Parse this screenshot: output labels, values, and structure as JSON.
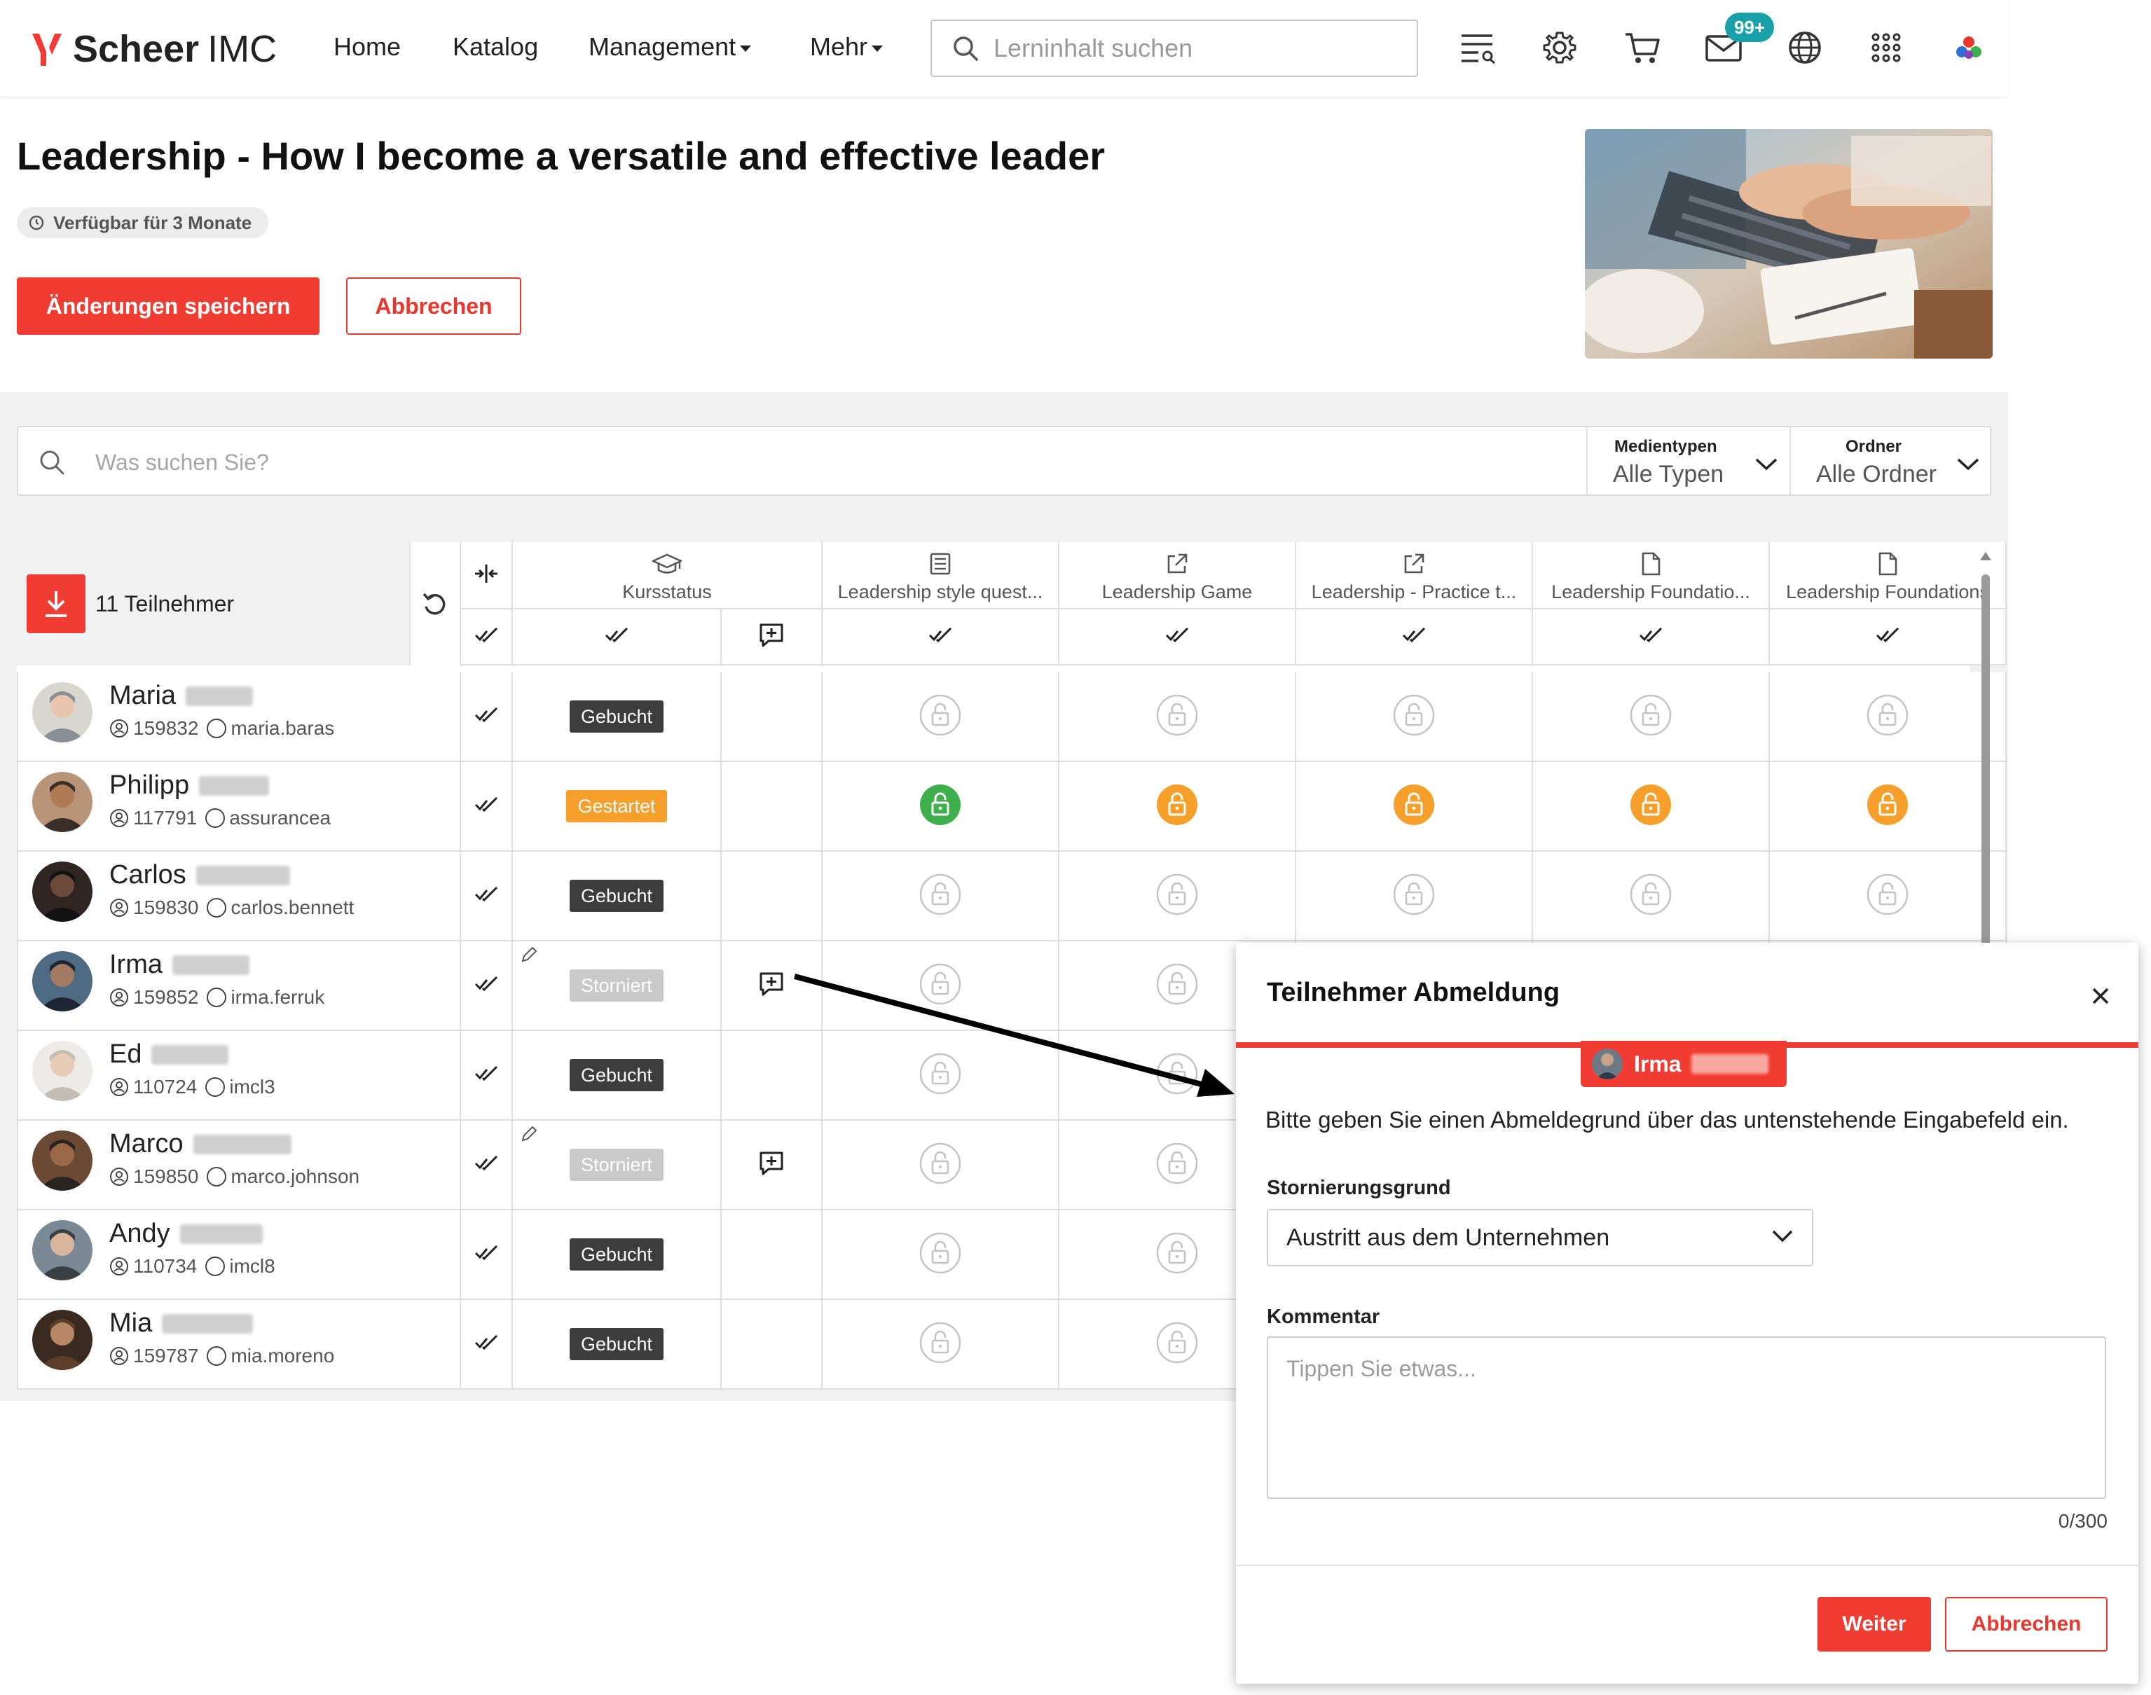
{
  "brand": {
    "name_strong": "Scheer",
    "name_light": "IMC",
    "accent": "#f03c32"
  },
  "nav": {
    "home": "Home",
    "catalog": "Katalog",
    "management": "Management",
    "more": "Mehr",
    "search_placeholder": "Lerninhalt suchen",
    "icons": [
      "filter-list-icon",
      "gear-icon",
      "cart-icon",
      "mail-icon",
      "globe-icon",
      "apps-grid-icon",
      "user-avatar"
    ],
    "mail_badge": "99+"
  },
  "course": {
    "title": "Leadership - How I become a versatile and effective leader",
    "availability": "Verfügbar für 3 Monate",
    "save_label": "Änderungen speichern",
    "cancel_label": "Abbrechen"
  },
  "filters": {
    "search_placeholder": "Was suchen Sie?",
    "media_label": "Medientypen",
    "media_value": "Alle Typen",
    "folder_label": "Ordner",
    "folder_value": "Alle Ordner"
  },
  "table": {
    "participants_label": "11 Teilnehmer",
    "status_header": "Kursstatus",
    "columns": [
      {
        "label": "Leadership style quest...",
        "icon": "questionnaire-icon"
      },
      {
        "label": "Leadership Game",
        "icon": "external-link-icon"
      },
      {
        "label": "Leadership - Practice t...",
        "icon": "external-link-icon"
      },
      {
        "label": "Leadership Foundatio...",
        "icon": "document-icon"
      },
      {
        "label": "Leadership Foundations",
        "icon": "document-icon"
      }
    ],
    "rows": [
      {
        "first_name": "Maria",
        "id": "159832",
        "username": "maria.baras",
        "status": "Gebucht",
        "status_kind": "gebucht",
        "comment": false,
        "locks": [
          "grey",
          "grey",
          "grey",
          "grey",
          "grey"
        ]
      },
      {
        "first_name": "Philipp",
        "id": "117791",
        "username": "assurancea",
        "status": "Gestartet",
        "status_kind": "gestartet",
        "comment": false,
        "locks": [
          "green",
          "orange",
          "orange",
          "orange",
          "orange"
        ]
      },
      {
        "first_name": "Carlos",
        "id": "159830",
        "username": "carlos.bennett",
        "status": "Gebucht",
        "status_kind": "gebucht",
        "comment": false,
        "locks": [
          "grey",
          "grey",
          "grey",
          "grey",
          "grey"
        ]
      },
      {
        "first_name": "Irma",
        "id": "159852",
        "username": "irma.ferruk",
        "status": "Storniert",
        "status_kind": "storniert",
        "comment": true,
        "locks": [
          "grey",
          "grey",
          "grey",
          "grey",
          "grey"
        ]
      },
      {
        "first_name": "Ed",
        "id": "110724",
        "username": "imcl3",
        "status": "Gebucht",
        "status_kind": "gebucht",
        "comment": false,
        "locks": [
          "grey",
          "grey",
          "grey",
          "grey",
          "grey"
        ]
      },
      {
        "first_name": "Marco",
        "id": "159850",
        "username": "marco.johnson",
        "status": "Storniert",
        "status_kind": "storniert",
        "comment": true,
        "locks": [
          "grey",
          "grey",
          "grey",
          "grey",
          "grey"
        ]
      },
      {
        "first_name": "Andy",
        "id": "110734",
        "username": "imcl8",
        "status": "Gebucht",
        "status_kind": "gebucht",
        "comment": false,
        "locks": [
          "grey",
          "grey",
          "grey",
          "grey",
          "grey"
        ]
      },
      {
        "first_name": "Mia",
        "id": "159787",
        "username": "mia.moreno",
        "status": "Gebucht",
        "status_kind": "gebucht",
        "comment": false,
        "locks": [
          "grey",
          "grey",
          "grey",
          "grey",
          "grey"
        ]
      }
    ]
  },
  "modal": {
    "title": "Teilnehmer Abmeldung",
    "user_first_name": "Irma",
    "instructions": "Bitte geben Sie einen Abmeldegrund über das untenstehende Eingabefeld ein.",
    "reason_label": "Stornierungsgrund",
    "reason_value": "Austritt aus dem Unternehmen",
    "comment_label": "Kommentar",
    "comment_placeholder": "Tippen Sie etwas...",
    "char_count": "0/300",
    "next_label": "Weiter",
    "cancel_label": "Abbrechen"
  },
  "colors": {
    "red": "#f03c32",
    "booked": "#3d3d3d",
    "started": "#f6a02b",
    "cancelled": "#c9c9c9",
    "lock_green": "#3fae4c",
    "lock_orange": "#f6a02b",
    "lock_grey": "#c4c4c4"
  }
}
